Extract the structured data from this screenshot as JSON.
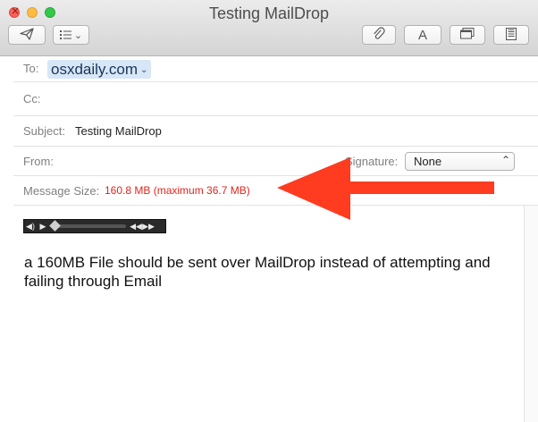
{
  "window": {
    "title": "Testing MailDrop"
  },
  "toolbar": {
    "send_icon": "paper-plane-icon",
    "format_icon": "list-format-icon",
    "format_chevron": "⌄",
    "attach_icon": "paperclip-icon",
    "font_label": "A",
    "window_icon": "window-icon",
    "stationery_icon": "stationery-icon"
  },
  "header": {
    "to_label": "To:",
    "to_value": "osxdaily.com",
    "cc_label": "Cc:",
    "subject_label": "Subject:",
    "subject_value": "Testing MailDrop",
    "from_label": "From:",
    "signature_label": "Signature:",
    "signature_value": "None",
    "size_label": "Message Size:",
    "size_value": "160.8 MB (maximum 36.7 MB)"
  },
  "annotation": {
    "arrow_color": "#ff3b20"
  },
  "body": {
    "text": "a 160MB File should be sent over MailDrop instead of attempting and failing through Email"
  },
  "colors": {
    "size_text": "#e3251b",
    "token_bg": "#d7e7f7"
  }
}
